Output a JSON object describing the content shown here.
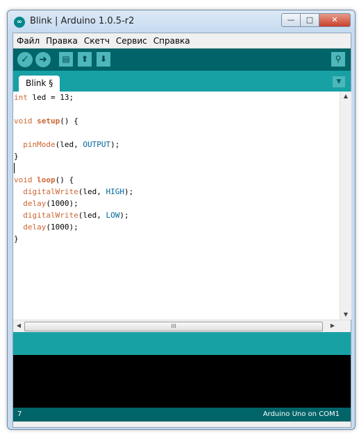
{
  "window": {
    "title": "Blink | Arduino 1.0.5-r2",
    "icon": "arduino-logo-icon",
    "controls": {
      "minimize": "—",
      "maximize": "□",
      "close": "✕"
    }
  },
  "menu": [
    "Файл",
    "Правка",
    "Скетч",
    "Сервис",
    "Справка"
  ],
  "toolbar": {
    "verify_icon": "✓",
    "upload_icon": "➜",
    "new_icon": "▤",
    "open_icon": "⬆",
    "save_icon": "⬇",
    "serial_monitor_icon": "⚲"
  },
  "tabs": [
    {
      "label": "Blink §"
    }
  ],
  "tab_menu_icon": "▼",
  "code": [
    [
      {
        "t": "int",
        "c": "kw-type"
      },
      {
        "t": " led = 13;"
      }
    ],
    [],
    [
      {
        "t": "void",
        "c": "kw-type"
      },
      {
        "t": " "
      },
      {
        "t": "setup",
        "c": "kw-fn"
      },
      {
        "t": "() {"
      }
    ],
    [],
    [
      {
        "t": "  "
      },
      {
        "t": "pinMode",
        "c": "kw-call"
      },
      {
        "t": "(led, "
      },
      {
        "t": "OUTPUT",
        "c": "kw-const"
      },
      {
        "t": ");"
      }
    ],
    [
      {
        "t": "}"
      }
    ],
    [],
    [
      {
        "t": "void",
        "c": "kw-type"
      },
      {
        "t": " "
      },
      {
        "t": "loop",
        "c": "kw-fn"
      },
      {
        "t": "() {"
      }
    ],
    [
      {
        "t": "  "
      },
      {
        "t": "digitalWrite",
        "c": "kw-call"
      },
      {
        "t": "(led, "
      },
      {
        "t": "HIGH",
        "c": "kw-const"
      },
      {
        "t": ");"
      }
    ],
    [
      {
        "t": "  "
      },
      {
        "t": "delay",
        "c": "kw-call"
      },
      {
        "t": "(1000);"
      }
    ],
    [
      {
        "t": "  "
      },
      {
        "t": "digitalWrite",
        "c": "kw-call"
      },
      {
        "t": "(led, "
      },
      {
        "t": "LOW",
        "c": "kw-const"
      },
      {
        "t": ");"
      }
    ],
    [
      {
        "t": "  "
      },
      {
        "t": "delay",
        "c": "kw-call"
      },
      {
        "t": "(1000);"
      }
    ],
    [
      {
        "t": "}"
      }
    ]
  ],
  "scrollbars": {
    "up": "▲",
    "down": "▼",
    "left": "◀",
    "right": "▶",
    "grip": "III"
  },
  "status": {
    "line_number": "7",
    "board": "Arduino Uno on COM1"
  }
}
